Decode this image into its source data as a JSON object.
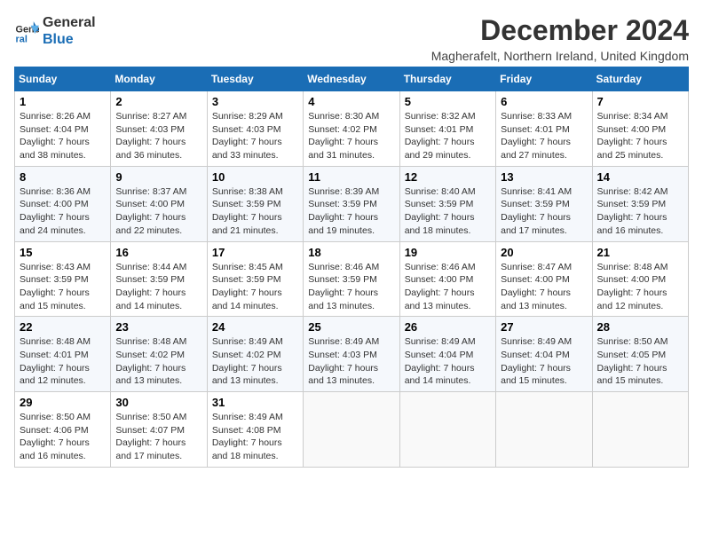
{
  "logo": {
    "line1": "General",
    "line2": "Blue"
  },
  "title": "December 2024",
  "location": "Magherafelt, Northern Ireland, United Kingdom",
  "weekdays": [
    "Sunday",
    "Monday",
    "Tuesday",
    "Wednesday",
    "Thursday",
    "Friday",
    "Saturday"
  ],
  "weeks": [
    [
      {
        "day": "1",
        "info": "Sunrise: 8:26 AM\nSunset: 4:04 PM\nDaylight: 7 hours\nand 38 minutes."
      },
      {
        "day": "2",
        "info": "Sunrise: 8:27 AM\nSunset: 4:03 PM\nDaylight: 7 hours\nand 36 minutes."
      },
      {
        "day": "3",
        "info": "Sunrise: 8:29 AM\nSunset: 4:03 PM\nDaylight: 7 hours\nand 33 minutes."
      },
      {
        "day": "4",
        "info": "Sunrise: 8:30 AM\nSunset: 4:02 PM\nDaylight: 7 hours\nand 31 minutes."
      },
      {
        "day": "5",
        "info": "Sunrise: 8:32 AM\nSunset: 4:01 PM\nDaylight: 7 hours\nand 29 minutes."
      },
      {
        "day": "6",
        "info": "Sunrise: 8:33 AM\nSunset: 4:01 PM\nDaylight: 7 hours\nand 27 minutes."
      },
      {
        "day": "7",
        "info": "Sunrise: 8:34 AM\nSunset: 4:00 PM\nDaylight: 7 hours\nand 25 minutes."
      }
    ],
    [
      {
        "day": "8",
        "info": "Sunrise: 8:36 AM\nSunset: 4:00 PM\nDaylight: 7 hours\nand 24 minutes."
      },
      {
        "day": "9",
        "info": "Sunrise: 8:37 AM\nSunset: 4:00 PM\nDaylight: 7 hours\nand 22 minutes."
      },
      {
        "day": "10",
        "info": "Sunrise: 8:38 AM\nSunset: 3:59 PM\nDaylight: 7 hours\nand 21 minutes."
      },
      {
        "day": "11",
        "info": "Sunrise: 8:39 AM\nSunset: 3:59 PM\nDaylight: 7 hours\nand 19 minutes."
      },
      {
        "day": "12",
        "info": "Sunrise: 8:40 AM\nSunset: 3:59 PM\nDaylight: 7 hours\nand 18 minutes."
      },
      {
        "day": "13",
        "info": "Sunrise: 8:41 AM\nSunset: 3:59 PM\nDaylight: 7 hours\nand 17 minutes."
      },
      {
        "day": "14",
        "info": "Sunrise: 8:42 AM\nSunset: 3:59 PM\nDaylight: 7 hours\nand 16 minutes."
      }
    ],
    [
      {
        "day": "15",
        "info": "Sunrise: 8:43 AM\nSunset: 3:59 PM\nDaylight: 7 hours\nand 15 minutes."
      },
      {
        "day": "16",
        "info": "Sunrise: 8:44 AM\nSunset: 3:59 PM\nDaylight: 7 hours\nand 14 minutes."
      },
      {
        "day": "17",
        "info": "Sunrise: 8:45 AM\nSunset: 3:59 PM\nDaylight: 7 hours\nand 14 minutes."
      },
      {
        "day": "18",
        "info": "Sunrise: 8:46 AM\nSunset: 3:59 PM\nDaylight: 7 hours\nand 13 minutes."
      },
      {
        "day": "19",
        "info": "Sunrise: 8:46 AM\nSunset: 4:00 PM\nDaylight: 7 hours\nand 13 minutes."
      },
      {
        "day": "20",
        "info": "Sunrise: 8:47 AM\nSunset: 4:00 PM\nDaylight: 7 hours\nand 13 minutes."
      },
      {
        "day": "21",
        "info": "Sunrise: 8:48 AM\nSunset: 4:00 PM\nDaylight: 7 hours\nand 12 minutes."
      }
    ],
    [
      {
        "day": "22",
        "info": "Sunrise: 8:48 AM\nSunset: 4:01 PM\nDaylight: 7 hours\nand 12 minutes."
      },
      {
        "day": "23",
        "info": "Sunrise: 8:48 AM\nSunset: 4:02 PM\nDaylight: 7 hours\nand 13 minutes."
      },
      {
        "day": "24",
        "info": "Sunrise: 8:49 AM\nSunset: 4:02 PM\nDaylight: 7 hours\nand 13 minutes."
      },
      {
        "day": "25",
        "info": "Sunrise: 8:49 AM\nSunset: 4:03 PM\nDaylight: 7 hours\nand 13 minutes."
      },
      {
        "day": "26",
        "info": "Sunrise: 8:49 AM\nSunset: 4:04 PM\nDaylight: 7 hours\nand 14 minutes."
      },
      {
        "day": "27",
        "info": "Sunrise: 8:49 AM\nSunset: 4:04 PM\nDaylight: 7 hours\nand 15 minutes."
      },
      {
        "day": "28",
        "info": "Sunrise: 8:50 AM\nSunset: 4:05 PM\nDaylight: 7 hours\nand 15 minutes."
      }
    ],
    [
      {
        "day": "29",
        "info": "Sunrise: 8:50 AM\nSunset: 4:06 PM\nDaylight: 7 hours\nand 16 minutes."
      },
      {
        "day": "30",
        "info": "Sunrise: 8:50 AM\nSunset: 4:07 PM\nDaylight: 7 hours\nand 17 minutes."
      },
      {
        "day": "31",
        "info": "Sunrise: 8:49 AM\nSunset: 4:08 PM\nDaylight: 7 hours\nand 18 minutes."
      },
      null,
      null,
      null,
      null
    ]
  ]
}
